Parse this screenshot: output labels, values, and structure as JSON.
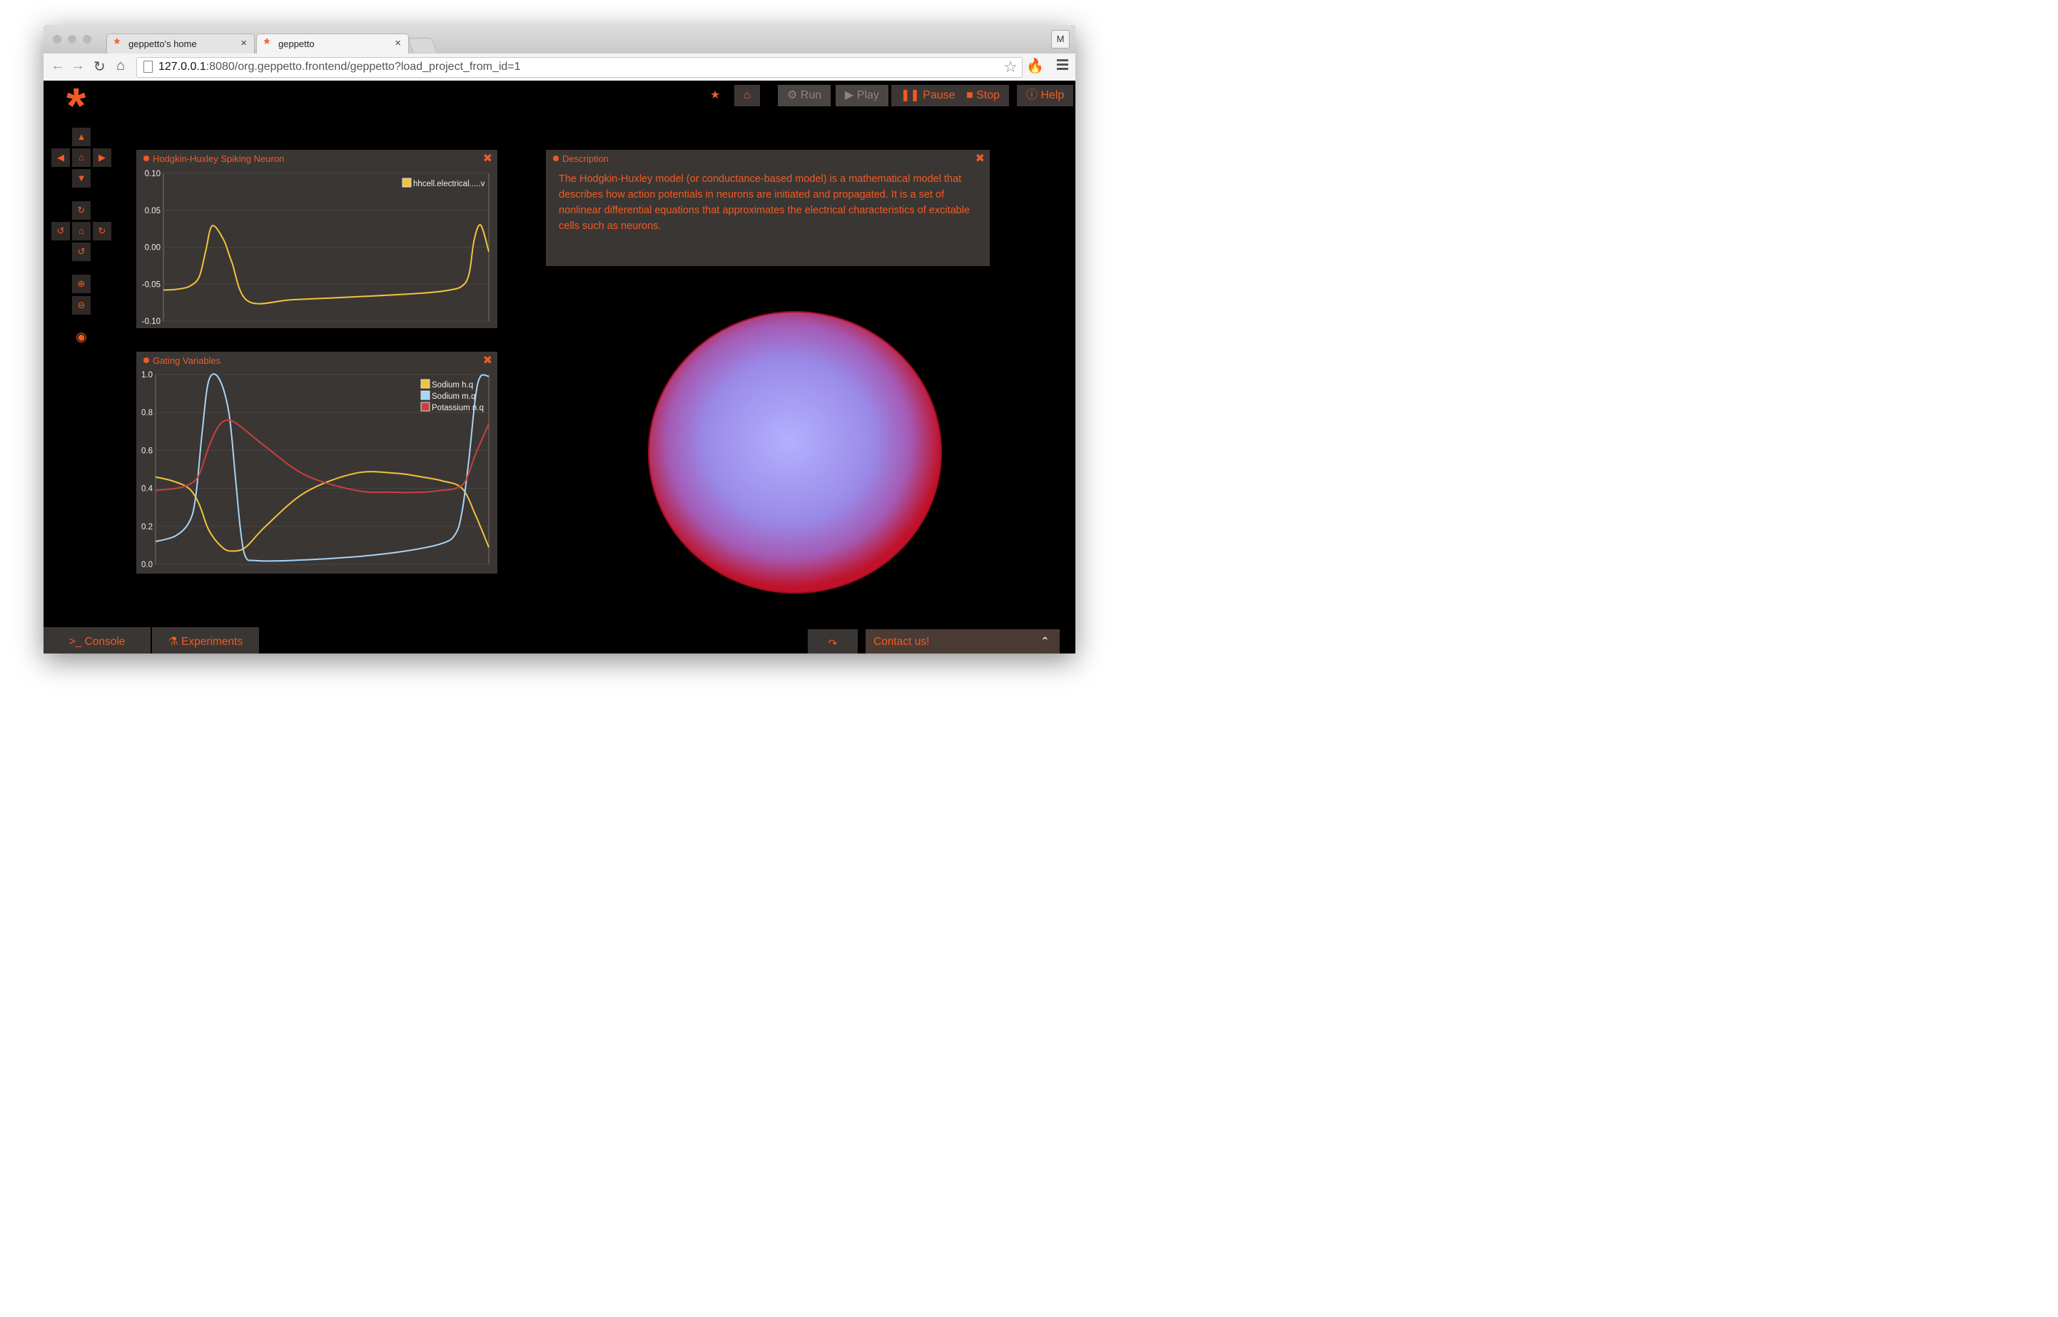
{
  "browser": {
    "tabs": [
      {
        "title": "geppetto's home",
        "close": "×"
      },
      {
        "title": "geppetto",
        "close": "×"
      }
    ],
    "profile_initial": "M",
    "url_host": "127.0.0.1",
    "url_rest": ":8080/org.geppetto.frontend/geppetto?load_project_from_id=1"
  },
  "app": {
    "logo": "*",
    "toolbar": {
      "run": "Run",
      "play": "Play",
      "pause": "Pause",
      "stop": "Stop",
      "help": "Help"
    },
    "panels": {
      "hh": {
        "title": "Hodgkin-Huxley Spiking Neuron"
      },
      "gating": {
        "title": "Gating Variables"
      },
      "description": {
        "title": "Description",
        "text": "The Hodgkin-Huxley model (or conductance-based model) is a mathematical model that describes how action potentials in neurons are initiated and propagated. It is a set of nonlinear differential equations that approximates the electrical characteristics of excitable cells such as neurons."
      }
    },
    "bottom": {
      "console": "Console",
      "experiments": "Experiments",
      "contact": "Contact us!"
    },
    "colors": {
      "accent": "#f05b23",
      "panel": "#3a3634",
      "sphere_center": "#b4b0ff",
      "sphere_edge": "#c0122a"
    }
  },
  "chart_data": [
    {
      "type": "line",
      "ylim": [
        -0.1,
        0.1
      ],
      "yticks": [
        "0.10",
        "0.05",
        "0.00",
        "-0.05",
        "-0.10"
      ],
      "series": [
        {
          "name": "hhcell.electrical.....v",
          "color": "#f2c33c",
          "x": [
            0,
            0.04,
            0.08,
            0.11,
            0.13,
            0.15,
            0.185,
            0.21,
            0.26,
            0.4,
            0.6,
            0.8,
            0.88,
            0.92,
            0.94,
            0.955,
            0.975,
            1.0
          ],
          "values": [
            -0.058,
            -0.057,
            -0.053,
            -0.04,
            -0.005,
            0.029,
            0.01,
            -0.02,
            -0.073,
            -0.071,
            -0.067,
            -0.062,
            -0.058,
            -0.052,
            -0.035,
            0.01,
            0.03,
            -0.006
          ]
        }
      ]
    },
    {
      "type": "line",
      "ylim": [
        0.0,
        1.0
      ],
      "yticks": [
        "1.0",
        "0.8",
        "0.6",
        "0.4",
        "0.2",
        "0.0"
      ],
      "series": [
        {
          "name": "Sodium h.q",
          "color": "#f2c33c",
          "x": [
            0,
            0.05,
            0.1,
            0.13,
            0.16,
            0.2,
            0.23,
            0.27,
            0.33,
            0.45,
            0.6,
            0.72,
            0.8,
            0.86,
            0.92,
            0.96,
            1.0
          ],
          "values": [
            0.46,
            0.44,
            0.4,
            0.32,
            0.18,
            0.09,
            0.07,
            0.09,
            0.2,
            0.38,
            0.48,
            0.48,
            0.46,
            0.44,
            0.4,
            0.26,
            0.09
          ]
        },
        {
          "name": "Sodium m.q",
          "color": "#a8d4f5",
          "x": [
            0,
            0.06,
            0.1,
            0.12,
            0.14,
            0.16,
            0.19,
            0.22,
            0.24,
            0.255,
            0.27,
            0.3,
            0.4,
            0.6,
            0.75,
            0.86,
            0.9,
            0.92,
            0.94,
            0.96,
            0.975,
            1.0
          ],
          "values": [
            0.12,
            0.15,
            0.22,
            0.35,
            0.7,
            0.97,
            0.98,
            0.8,
            0.45,
            0.18,
            0.04,
            0.02,
            0.02,
            0.04,
            0.07,
            0.11,
            0.16,
            0.28,
            0.55,
            0.88,
            0.99,
            0.99
          ]
        },
        {
          "name": "Potassium n.q",
          "color": "#c8413f",
          "x": [
            0,
            0.06,
            0.1,
            0.13,
            0.16,
            0.19,
            0.22,
            0.26,
            0.33,
            0.45,
            0.6,
            0.7,
            0.8,
            0.86,
            0.9,
            0.93,
            0.96,
            1.0
          ],
          "values": [
            0.39,
            0.4,
            0.42,
            0.47,
            0.62,
            0.73,
            0.76,
            0.72,
            0.62,
            0.47,
            0.39,
            0.38,
            0.38,
            0.39,
            0.4,
            0.44,
            0.58,
            0.74
          ]
        }
      ]
    }
  ]
}
